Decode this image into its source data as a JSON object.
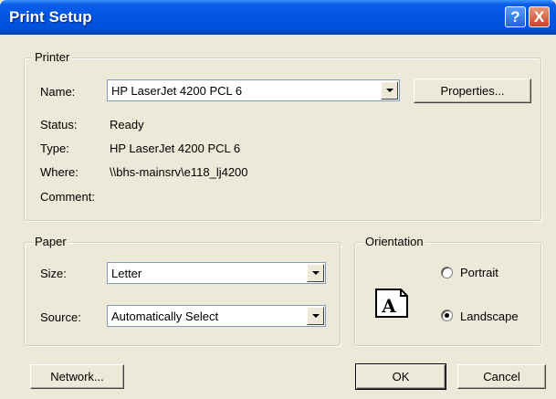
{
  "window": {
    "title": "Print Setup",
    "help_glyph": "?",
    "close_glyph": "X"
  },
  "printer": {
    "group_label": "Printer",
    "name_label": "Name:",
    "name_value": "HP LaserJet 4200 PCL 6",
    "properties_button": "Properties...",
    "status_label": "Status:",
    "status_value": "Ready",
    "type_label": "Type:",
    "type_value": "HP LaserJet 4200 PCL 6",
    "where_label": "Where:",
    "where_value": "\\\\bhs-mainsrv\\e118_lj4200",
    "comment_label": "Comment:",
    "comment_value": ""
  },
  "paper": {
    "group_label": "Paper",
    "size_label": "Size:",
    "size_value": "Letter",
    "source_label": "Source:",
    "source_value": "Automatically Select"
  },
  "orientation": {
    "group_label": "Orientation",
    "icon_letter": "A",
    "options": [
      {
        "label": "Portrait",
        "checked": false
      },
      {
        "label": "Landscape",
        "checked": true
      }
    ]
  },
  "buttons": {
    "network": "Network...",
    "ok": "OK",
    "cancel": "Cancel"
  },
  "colors": {
    "titlebar": "#0054e3",
    "dialog_bg": "#ece9d8",
    "close_button": "#c9432a"
  }
}
